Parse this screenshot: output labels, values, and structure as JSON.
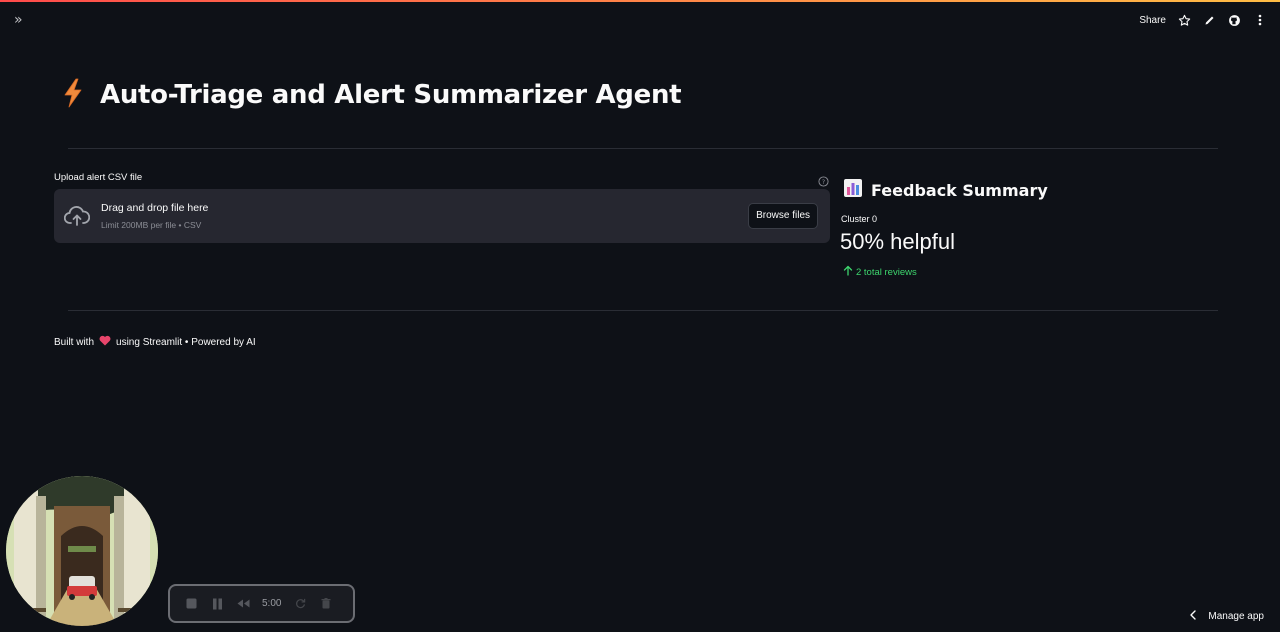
{
  "header": {
    "share_label": "Share",
    "icons": [
      "sidebar-expand-icon",
      "star-icon",
      "edit-icon",
      "github-icon",
      "more-vertical-icon"
    ]
  },
  "main": {
    "title": "Auto-Triage and Alert Summarizer Agent",
    "title_icon": "lightning-icon",
    "uploader": {
      "label": "Upload alert CSV file",
      "drag_text": "Drag and drop file here",
      "limit_text": "Limit 200MB per file • CSV",
      "browse_label": "Browse files"
    }
  },
  "feedback": {
    "title": "Feedback Summary",
    "title_icon": "bar-chart-icon",
    "metric_label": "Cluster 0",
    "metric_value": "50% helpful",
    "metric_delta": "2 total reviews",
    "delta_color": "#3dd56d"
  },
  "footer": {
    "built_with": "Built with",
    "rest": "using Streamlit • Powered by AI",
    "heart_icon": "heart-icon"
  },
  "recorder": {
    "time": "5:00"
  },
  "manage_app": {
    "label": "Manage app"
  },
  "colors": {
    "background": "#0e1117",
    "panel": "#262730",
    "accent": "#ff4b4b",
    "success": "#3dd56d"
  }
}
